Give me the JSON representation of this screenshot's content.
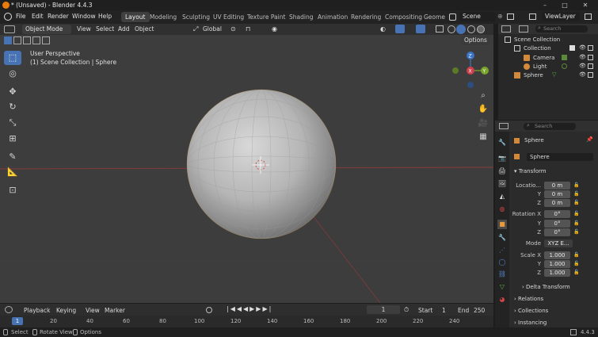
{
  "title_bar": {
    "title": "* (Unsaved) - Blender 4.4.3",
    "minimize": "–",
    "maximize": "□",
    "close": "✕"
  },
  "menus": [
    "File",
    "Edit",
    "Render",
    "Window",
    "Help"
  ],
  "workspaces": [
    "Layout",
    "Modeling",
    "Sculpting",
    "UV Editing",
    "Texture Paint",
    "Shading",
    "Animation",
    "Rendering",
    "Compositing",
    "Geome"
  ],
  "active_workspace": "Layout",
  "scene": {
    "name": "Scene",
    "view_layer": "ViewLayer"
  },
  "viewport_header": {
    "mode": "Object Mode",
    "menus": [
      "View",
      "Select",
      "Add",
      "Object"
    ],
    "transform_orientation": "Global",
    "options": "Options"
  },
  "viewport": {
    "perspective_label": "User Perspective",
    "collection_label": "(1) Scene Collection | Sphere",
    "background": "#3d3d3d",
    "accent": "#4772b3"
  },
  "gizmo": {
    "x": "X",
    "y": "Y",
    "z": "Z"
  },
  "outliner": {
    "search_placeholder": "Search",
    "items": [
      {
        "label": "Scene Collection",
        "icon": "scene-collection-icon"
      },
      {
        "label": "Collection",
        "icon": "collection-icon"
      },
      {
        "label": "Camera",
        "icon": "camera-icon"
      },
      {
        "label": "Light",
        "icon": "light-icon"
      },
      {
        "label": "Sphere",
        "icon": "mesh-icon"
      }
    ]
  },
  "properties": {
    "search_placeholder": "Search",
    "object_name": "Sphere",
    "object_field": "Sphere",
    "transform_label": "Transform",
    "location_label": "Locatio...",
    "location": [
      "0 m",
      "0 m",
      "0 m"
    ],
    "rotation_label": "Rotation X",
    "rotation": [
      "0°",
      "0°",
      "0°"
    ],
    "mode_label": "Mode",
    "mode": "XYZ E...",
    "scale_label": "Scale X",
    "scale": [
      "1.000",
      "1.000",
      "1.000"
    ],
    "axis_labels": [
      "Y",
      "Z"
    ],
    "sections": [
      "Delta Transform",
      "Relations",
      "Collections",
      "Instancing"
    ]
  },
  "timeline": {
    "menus": [
      "Playback",
      "Keying",
      "View",
      "Marker"
    ],
    "current_frame": "1",
    "start_label": "Start",
    "start": "1",
    "end_label": "End",
    "end": "250",
    "ticks": [
      "1",
      "20",
      "40",
      "60",
      "80",
      "100",
      "120",
      "140",
      "160",
      "180",
      "200",
      "220",
      "240"
    ]
  },
  "status_bar": {
    "select": "Select",
    "rotate": "Rotate View",
    "options": "Options",
    "version": "4.4.3"
  }
}
